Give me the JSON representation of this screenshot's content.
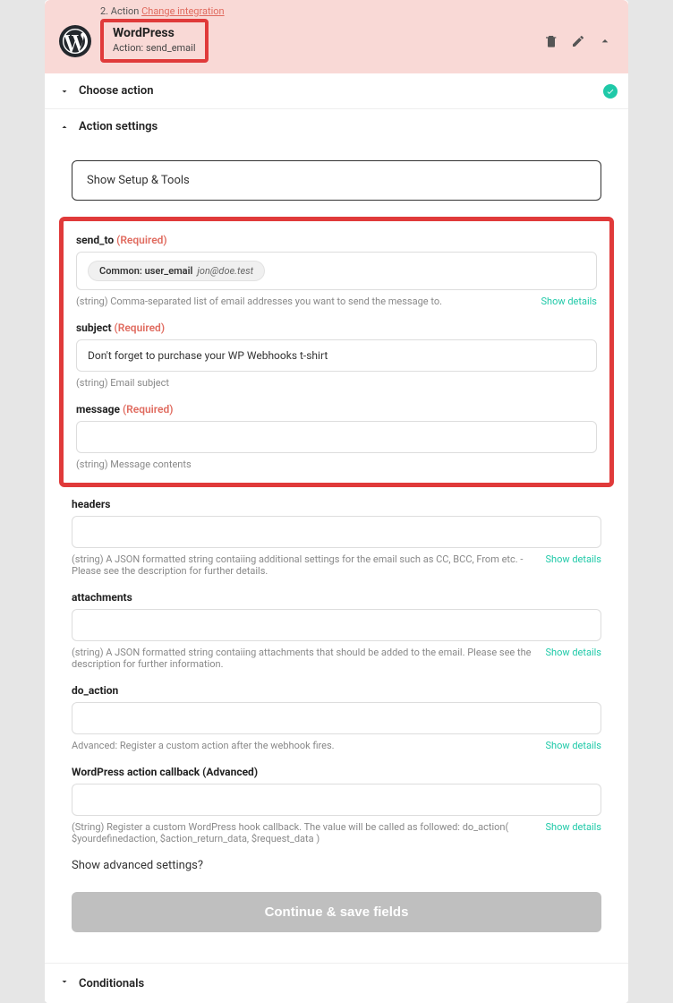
{
  "header": {
    "step_prefix": "2. Action",
    "change_link": "Change integration",
    "title": "WordPress",
    "subtitle": "Action: send_email"
  },
  "sections": {
    "choose_action": "Choose action",
    "action_settings": "Action settings",
    "conditionals": "Conditionals"
  },
  "setup_bar": "Show Setup & Tools",
  "fields": {
    "send_to": {
      "label": "send_to",
      "required": "(Required)",
      "pill_key": "Common: user_email",
      "pill_value": "jon@doe.test",
      "hint": "(string) Comma-separated list of email addresses you want to send the message to.",
      "details": "Show details"
    },
    "subject": {
      "label": "subject",
      "required": "(Required)",
      "value": "Don't forget to purchase your WP Webhooks t-shirt",
      "hint": "(string) Email subject"
    },
    "message": {
      "label": "message",
      "required": "(Required)",
      "hint": "(string) Message contents"
    },
    "headers": {
      "label": "headers",
      "hint": "(string) A JSON formatted string contaiing additional settings for the email such as CC, BCC, From etc. - Please see the description for further details.",
      "details": "Show details"
    },
    "attachments": {
      "label": "attachments",
      "hint": "(string) A JSON formatted string contaiing attachments that should be added to the email. Please see the description for further information.",
      "details": "Show details"
    },
    "do_action": {
      "label": "do_action",
      "hint": "Advanced: Register a custom action after the webhook fires.",
      "details": "Show details"
    },
    "callback": {
      "label": "WordPress action callback (Advanced)",
      "hint": "(String) Register a custom WordPress hook callback. The value will be called as followed: do_action( $yourdefinedaction, $action_return_data, $request_data )",
      "details": "Show details"
    }
  },
  "advanced_link": "Show advanced settings?",
  "continue_button": "Continue & save fields"
}
